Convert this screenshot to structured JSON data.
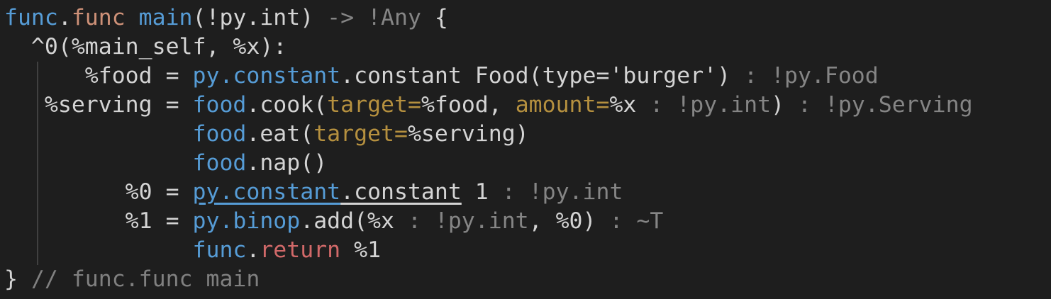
{
  "editor": {
    "language": "mlir",
    "colors": {
      "background": "#1e1e1e",
      "text": "#d4d4d4",
      "dialect": "#569cd6",
      "operation": "#ce9178",
      "keyword_arg": "#b5903f",
      "type": "#858585",
      "return_kw": "#d16969"
    },
    "lines": [
      {
        "n": 0,
        "tokens": [
          {
            "t": "func",
            "c": "tok-fn"
          },
          {
            "t": ".",
            "c": ""
          },
          {
            "t": "func",
            "c": "tok-op"
          },
          {
            "t": " ",
            "c": ""
          },
          {
            "t": "main",
            "c": "tok-fn"
          },
          {
            "t": "(!py.int) ",
            "c": ""
          },
          {
            "t": "-> !Any",
            "c": "tok-ty"
          },
          {
            "t": " {",
            "c": ""
          }
        ]
      },
      {
        "n": 1,
        "tokens": [
          {
            "t": "  ^0(%main_self, %x):",
            "c": ""
          }
        ]
      },
      {
        "n": 2,
        "tokens": [
          {
            "t": "      %food = ",
            "c": ""
          },
          {
            "t": "py.constant",
            "c": "tok-fn"
          },
          {
            "t": ".constant Food(type='burger') ",
            "c": ""
          },
          {
            "t": ": !py.Food",
            "c": "tok-ty"
          }
        ]
      },
      {
        "n": 3,
        "tokens": [
          {
            "t": "   %serving = ",
            "c": ""
          },
          {
            "t": "food",
            "c": "tok-fn"
          },
          {
            "t": ".cook(",
            "c": ""
          },
          {
            "t": "target=",
            "c": "tok-kw"
          },
          {
            "t": "%food, ",
            "c": ""
          },
          {
            "t": "amount=",
            "c": "tok-kw"
          },
          {
            "t": "%x ",
            "c": ""
          },
          {
            "t": ": !py.int",
            "c": "tok-ty"
          },
          {
            "t": ") ",
            "c": ""
          },
          {
            "t": ": !py.Serving",
            "c": "tok-ty"
          }
        ]
      },
      {
        "n": 4,
        "tokens": [
          {
            "t": "              ",
            "c": ""
          },
          {
            "t": "food",
            "c": "tok-fn"
          },
          {
            "t": ".eat(",
            "c": ""
          },
          {
            "t": "target=",
            "c": "tok-kw"
          },
          {
            "t": "%serving)",
            "c": ""
          }
        ]
      },
      {
        "n": 5,
        "tokens": [
          {
            "t": "              ",
            "c": ""
          },
          {
            "t": "food",
            "c": "tok-fn"
          },
          {
            "t": ".nap()",
            "c": ""
          }
        ]
      },
      {
        "n": 6,
        "tokens": [
          {
            "t": "         %0 = ",
            "c": ""
          },
          {
            "t": "py.constant",
            "c": "tok-fn tok-ul"
          },
          {
            "t": ".constant",
            "c": "tok-ul"
          },
          {
            "t": " 1 ",
            "c": ""
          },
          {
            "t": ": !py.int",
            "c": "tok-ty"
          }
        ]
      },
      {
        "n": 7,
        "tokens": [
          {
            "t": "         %1 = ",
            "c": ""
          },
          {
            "t": "py.binop",
            "c": "tok-fn"
          },
          {
            "t": ".add(%x ",
            "c": ""
          },
          {
            "t": ": !py.int",
            "c": "tok-ty"
          },
          {
            "t": ", %0) ",
            "c": ""
          },
          {
            "t": ": ~T",
            "c": "tok-ty"
          }
        ]
      },
      {
        "n": 8,
        "tokens": [
          {
            "t": "              ",
            "c": ""
          },
          {
            "t": "func",
            "c": "tok-fn"
          },
          {
            "t": ".",
            "c": ""
          },
          {
            "t": "return",
            "c": "tok-ret"
          },
          {
            "t": " %1",
            "c": ""
          }
        ]
      },
      {
        "n": 9,
        "tokens": [
          {
            "t": "} ",
            "c": ""
          },
          {
            "t": "// func.func main",
            "c": "tok-cm"
          }
        ]
      }
    ]
  }
}
